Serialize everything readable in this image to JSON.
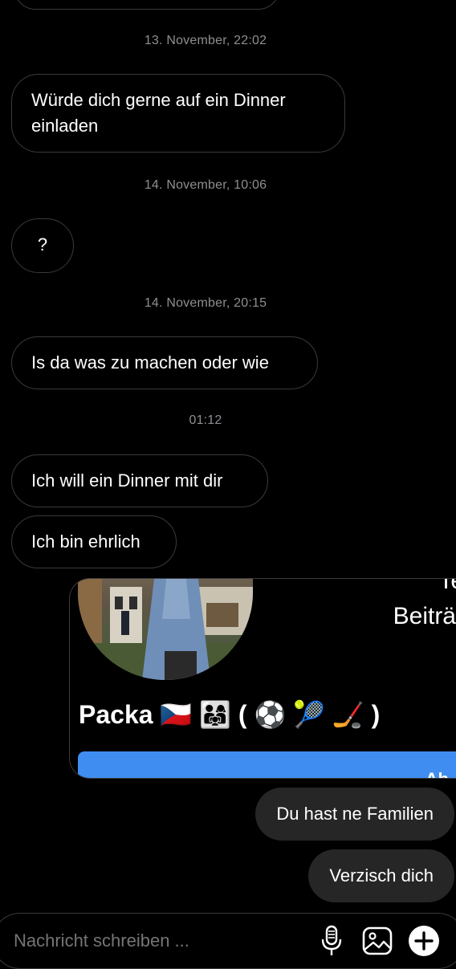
{
  "timestamps": [
    "13. November, 22:02",
    "14. November, 10:06",
    "14. November, 20:15",
    "01:12"
  ],
  "messages_in": [
    {
      "text": "Würde dich gerne auf ein Dinner einladen"
    },
    {
      "text": "?"
    },
    {
      "text": "Is da was zu machen oder wie"
    },
    {
      "text": "Ich will ein Dinner mit dir"
    },
    {
      "text": "Ich bin ehrlich"
    }
  ],
  "shared_profile": {
    "partial_top_text": "Te",
    "partial_label": "Beiträ",
    "name_line": "Packa 🇨🇿 👨‍👩‍👧 ( ⚽ 🎾 🏒 )",
    "button_partial_text": "Ab"
  },
  "messages_out": [
    {
      "text": "Du hast ne Familien"
    },
    {
      "text": "Verzisch dich"
    }
  ],
  "composer": {
    "placeholder": "Nachricht schreiben ...",
    "icons": [
      "microphone-icon",
      "image-icon",
      "plus-icon"
    ]
  },
  "colors": {
    "background": "#000000",
    "incoming_border": "#3a3a3c",
    "outgoing_bubble": "#262626",
    "timestamp": "#8e8e93",
    "profile_button": "#3f8df0"
  }
}
